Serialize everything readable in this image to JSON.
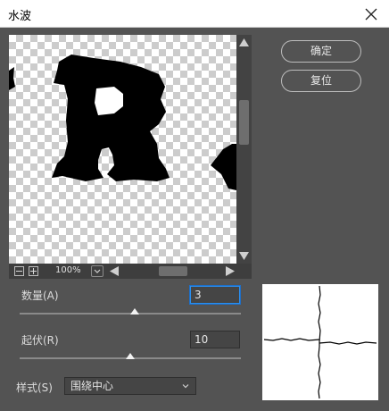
{
  "window": {
    "title": "水波"
  },
  "preview": {
    "zoom_value": "100%"
  },
  "buttons": {
    "ok_label": "确定",
    "reset_label": "复位"
  },
  "params": {
    "amount": {
      "label": "数量(A)",
      "value": "3",
      "slider_fraction": 0.52
    },
    "ridges": {
      "label": "起伏(R)",
      "value": "10",
      "slider_fraction": 0.5
    },
    "style": {
      "label": "样式(S)",
      "selected": "围绕中心"
    }
  },
  "icons": {
    "close": "close-icon",
    "zoom_out": "zoom-out-icon",
    "zoom_in": "zoom-in-icon",
    "dropdown": "chevron-down-icon",
    "scroll_up": "arrow-up-icon",
    "scroll_down": "arrow-down-icon",
    "scroll_left": "arrow-left-icon",
    "scroll_right": "arrow-right-icon"
  }
}
